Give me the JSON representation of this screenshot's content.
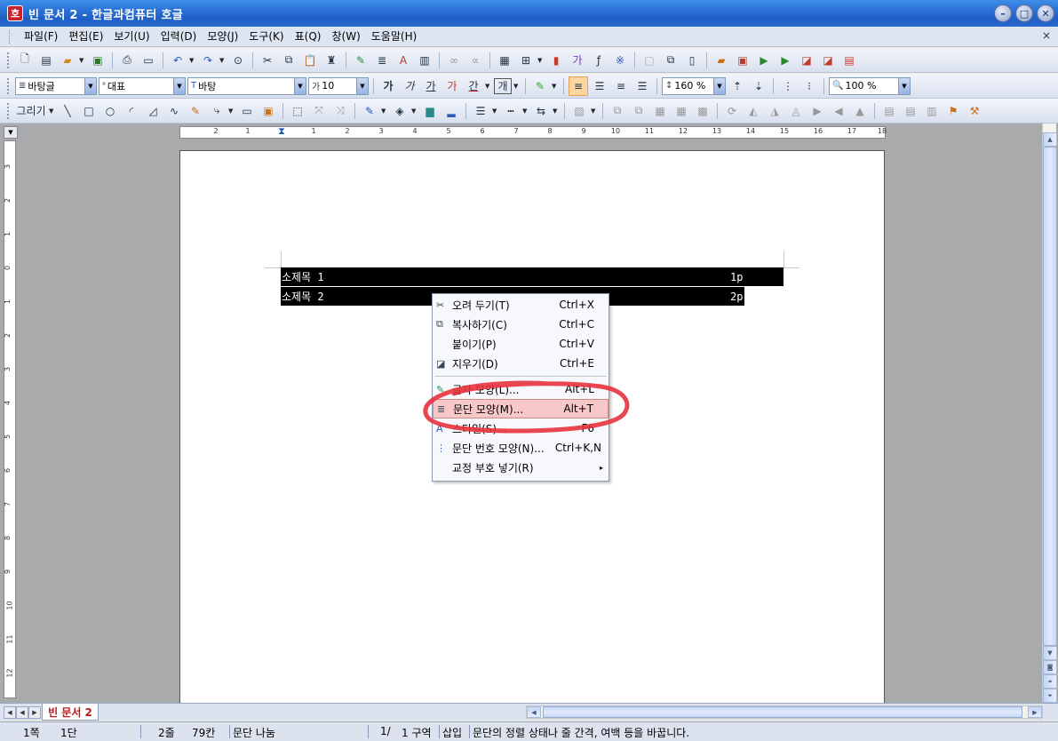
{
  "window": {
    "title": "빈 문서 2 - 한글과컴퓨터 호글",
    "app_icon": "호",
    "minimize_icon": "minimize-icon",
    "maximize_icon": "maximize-icon",
    "close_icon": "close-icon"
  },
  "menubar": {
    "items": [
      "파일(F)",
      "편집(E)",
      "보기(U)",
      "입력(D)",
      "모양(J)",
      "도구(K)",
      "표(Q)",
      "창(W)",
      "도움말(H)"
    ],
    "doc_close": "×"
  },
  "formatbar": {
    "style": "바탕글",
    "lang": "대표",
    "font": "바탕",
    "size": "10",
    "line_spacing": "160 %",
    "zoom": "100 %",
    "bold": "가",
    "italic": "가",
    "underline": "가",
    "strike": "가",
    "color": "간",
    "border": "개"
  },
  "drawbar": {
    "draw_label": "그리기"
  },
  "rulers": {
    "h_ticks": [
      "2",
      "1",
      "1",
      "2",
      "3",
      "4",
      "5",
      "6",
      "7",
      "8",
      "9",
      "10",
      "11",
      "12",
      "13",
      "14",
      "15",
      "16",
      "17",
      "18"
    ],
    "v_ticks": [
      "3",
      "2",
      "1",
      "0",
      "1",
      "2",
      "3",
      "4",
      "5",
      "6",
      "7",
      "8",
      "9",
      "10",
      "11",
      "12"
    ]
  },
  "document": {
    "rows": [
      {
        "text": "소제목 1",
        "page": "1p"
      },
      {
        "text": "소제목 2",
        "page": "2p"
      }
    ]
  },
  "context_menu": {
    "items": [
      {
        "label": "오려 두기(T)",
        "shortcut": "Ctrl+X",
        "icon": "scissors-icon"
      },
      {
        "label": "복사하기(C)",
        "shortcut": "Ctrl+C",
        "icon": "copy-icon"
      },
      {
        "label": "붙이기(P)",
        "shortcut": "Ctrl+V",
        "icon": ""
      },
      {
        "label": "지우기(D)",
        "shortcut": "Ctrl+E",
        "icon": "eraser-icon"
      },
      {
        "label": "글자 모양(L)...",
        "shortcut": "Alt+L",
        "icon": "char-shape-icon"
      },
      {
        "label": "문단 모양(M)...",
        "shortcut": "Alt+T",
        "icon": "paragraph-shape-icon"
      },
      {
        "label": "스타일(S)...",
        "shortcut": "F6",
        "icon": "style-icon"
      },
      {
        "label": "문단 번호 모양(N)...",
        "shortcut": "Ctrl+K,N",
        "icon": "numbering-icon"
      },
      {
        "label": "교정 부호 넣기(R)",
        "shortcut": "",
        "icon": ""
      }
    ],
    "highlight_color": "#f6c8c8",
    "annotation_color": "#e8323c"
  },
  "tabs": {
    "active": "빈 문서 2"
  },
  "statusbar": {
    "page": "1쪽",
    "column": "1단",
    "line": "2줄",
    "col_pos": "79칸",
    "mode": "문단 나눔",
    "section_page": "1/",
    "section": "1 구역",
    "insert": "삽입",
    "hint": "문단의 정렬 상태나 줄 간격, 여백 등을 바꿉니다."
  }
}
